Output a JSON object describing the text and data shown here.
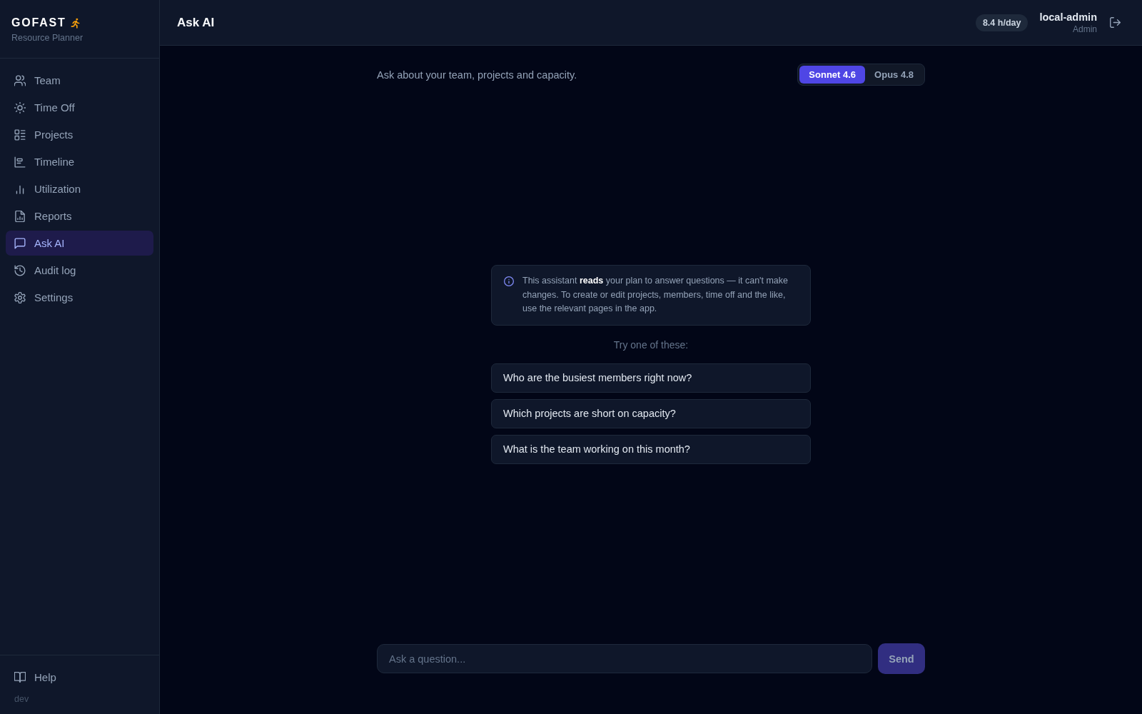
{
  "sidebar": {
    "brand": {
      "name": "GOFAST",
      "subtitle": "Resource Planner"
    },
    "items": [
      {
        "label": "Team",
        "selected": false
      },
      {
        "label": "Time Off",
        "selected": false
      },
      {
        "label": "Projects",
        "selected": false
      },
      {
        "label": "Timeline",
        "selected": false
      },
      {
        "label": "Utilization",
        "selected": false
      },
      {
        "label": "Reports",
        "selected": false
      },
      {
        "label": "Ask AI",
        "selected": true
      },
      {
        "label": "Audit log",
        "selected": false
      },
      {
        "label": "Settings",
        "selected": false
      }
    ],
    "footer_items": [
      {
        "label": "Help"
      }
    ],
    "version": "dev"
  },
  "header": {
    "title": "Ask AI",
    "capacity_badge": "8.4 h/day",
    "user": {
      "name": "local-admin",
      "role": "Admin"
    }
  },
  "intro": "Ask about your team, projects and capacity.",
  "model_options": [
    {
      "label": "Sonnet 4.6",
      "selected": true
    },
    {
      "label": "Opus 4.8",
      "selected": false
    }
  ],
  "notice": "This assistant **reads** your plan to answer questions — it can't make changes. To create or edit projects, members, time off and the like, use the relevant pages in the app.",
  "suggestions_heading": "Try one of these:",
  "suggestions": [
    "Who are the busiest members right now?",
    "Which projects are short on capacity?",
    "What is the team working on this month?"
  ],
  "composer": {
    "placeholder": "Ask a question...",
    "send": {
      "label": "Send",
      "disabled": true
    }
  }
}
